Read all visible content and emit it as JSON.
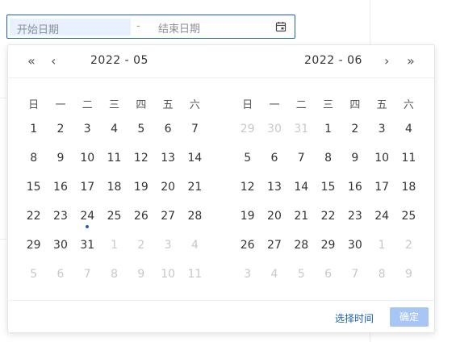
{
  "range": {
    "start_placeholder": "开始日期",
    "separator": "-",
    "end_placeholder": "结束日期"
  },
  "left_panel": {
    "title": "2022 - 05",
    "prev_year": "«",
    "prev_month": "‹",
    "weekdays": [
      "日",
      "一",
      "二",
      "三",
      "四",
      "五",
      "六"
    ],
    "weeks": [
      [
        {
          "d": "1"
        },
        {
          "d": "2"
        },
        {
          "d": "3"
        },
        {
          "d": "4"
        },
        {
          "d": "5"
        },
        {
          "d": "6"
        },
        {
          "d": "7"
        }
      ],
      [
        {
          "d": "8"
        },
        {
          "d": "9"
        },
        {
          "d": "10"
        },
        {
          "d": "11"
        },
        {
          "d": "12"
        },
        {
          "d": "13"
        },
        {
          "d": "14"
        }
      ],
      [
        {
          "d": "15"
        },
        {
          "d": "16"
        },
        {
          "d": "17"
        },
        {
          "d": "18"
        },
        {
          "d": "19"
        },
        {
          "d": "20"
        },
        {
          "d": "21"
        }
      ],
      [
        {
          "d": "22"
        },
        {
          "d": "23"
        },
        {
          "d": "24",
          "today": true
        },
        {
          "d": "25"
        },
        {
          "d": "26"
        },
        {
          "d": "27"
        },
        {
          "d": "28"
        }
      ],
      [
        {
          "d": "29"
        },
        {
          "d": "30"
        },
        {
          "d": "31"
        },
        {
          "d": "1",
          "other": true
        },
        {
          "d": "2",
          "other": true
        },
        {
          "d": "3",
          "other": true
        },
        {
          "d": "4",
          "other": true
        }
      ],
      [
        {
          "d": "5",
          "other": true
        },
        {
          "d": "6",
          "other": true
        },
        {
          "d": "7",
          "other": true
        },
        {
          "d": "8",
          "other": true
        },
        {
          "d": "9",
          "other": true
        },
        {
          "d": "10",
          "other": true
        },
        {
          "d": "11",
          "other": true
        }
      ]
    ]
  },
  "right_panel": {
    "title": "2022 - 06",
    "next_month": "›",
    "next_year": "»",
    "weekdays": [
      "日",
      "一",
      "二",
      "三",
      "四",
      "五",
      "六"
    ],
    "weeks": [
      [
        {
          "d": "29",
          "other": true
        },
        {
          "d": "30",
          "other": true
        },
        {
          "d": "31",
          "other": true
        },
        {
          "d": "1"
        },
        {
          "d": "2"
        },
        {
          "d": "3"
        },
        {
          "d": "4"
        }
      ],
      [
        {
          "d": "5"
        },
        {
          "d": "6"
        },
        {
          "d": "7"
        },
        {
          "d": "8"
        },
        {
          "d": "9"
        },
        {
          "d": "10"
        },
        {
          "d": "11"
        }
      ],
      [
        {
          "d": "12"
        },
        {
          "d": "13"
        },
        {
          "d": "14"
        },
        {
          "d": "15"
        },
        {
          "d": "16"
        },
        {
          "d": "17"
        },
        {
          "d": "18"
        }
      ],
      [
        {
          "d": "19"
        },
        {
          "d": "20"
        },
        {
          "d": "21"
        },
        {
          "d": "22"
        },
        {
          "d": "23"
        },
        {
          "d": "24"
        },
        {
          "d": "25"
        }
      ],
      [
        {
          "d": "26"
        },
        {
          "d": "27"
        },
        {
          "d": "28"
        },
        {
          "d": "29"
        },
        {
          "d": "30"
        },
        {
          "d": "1",
          "other": true
        },
        {
          "d": "2",
          "other": true
        }
      ],
      [
        {
          "d": "3",
          "other": true
        },
        {
          "d": "4",
          "other": true
        },
        {
          "d": "5",
          "other": true
        },
        {
          "d": "6",
          "other": true
        },
        {
          "d": "7",
          "other": true
        },
        {
          "d": "8",
          "other": true
        },
        {
          "d": "9",
          "other": true
        }
      ]
    ]
  },
  "footer": {
    "select_time": "选择时间",
    "confirm": "确定"
  },
  "colors": {
    "accent": "#1c5ec7",
    "confirm_disabled": "#a7c6f5",
    "start_highlight": "#e8f1ff",
    "other_month": "#c8c8c8"
  },
  "icons": {
    "calendar": "calendar-icon"
  }
}
